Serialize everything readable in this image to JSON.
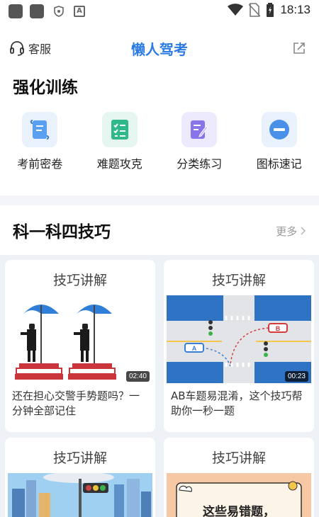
{
  "status_bar": {
    "time": "18:13",
    "a_glyph": "A",
    "left_icons": [
      "app-icon",
      "app-icon",
      "shield-icon",
      "a-icon"
    ],
    "right_icons": [
      "wifi-icon",
      "no-sim-icon",
      "battery-icon"
    ]
  },
  "header": {
    "support_label": "客服",
    "title": "懒人驾考",
    "title_color": "#2c7be5",
    "right_icon": "share-icon"
  },
  "training": {
    "title": "强化训练",
    "items": [
      {
        "label": "考前密卷",
        "icon": "scroll-icon"
      },
      {
        "label": "难题攻克",
        "icon": "checklist-icon"
      },
      {
        "label": "分类练习",
        "icon": "edit-note-icon"
      },
      {
        "label": "图标速记",
        "icon": "minus-circle-icon"
      }
    ]
  },
  "skills": {
    "title": "科一科四技巧",
    "more_label": "更多",
    "more_icon": "chevron-right-icon",
    "cards": [
      {
        "header": "技巧讲解",
        "duration": "02:40",
        "desc": "还在担心交警手势题吗？一分钟全部记住",
        "thumb": "traffic-police-thumbnail"
      },
      {
        "header": "技巧讲解",
        "duration": "00:23",
        "desc": "AB车题易混淆，这个技巧帮助你一秒一题",
        "thumb": "intersection-diagram-thumbnail",
        "car_a_label": "A",
        "car_b_label": "B"
      },
      {
        "header": "技巧讲解",
        "thumb": "city-traffic-light-thumbnail"
      },
      {
        "header": "技巧讲解",
        "thumb": "error-prone-poster-thumbnail",
        "thumb_text": "这些易错题，"
      }
    ]
  }
}
